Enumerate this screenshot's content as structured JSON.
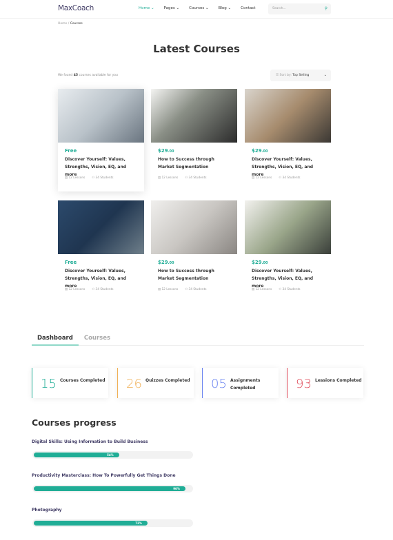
{
  "header": {
    "logo": "MaxCoach",
    "nav": [
      "Home",
      "Pages",
      "Courses",
      "Blog",
      "Contact"
    ],
    "search_placeholder": "Search..."
  },
  "breadcrumb": {
    "home": "Home",
    "sep": "/",
    "current": "Courses"
  },
  "page_title": "Latest Courses",
  "found": {
    "pre": "We found",
    "count": "45",
    "post": "courses available for you"
  },
  "sort": {
    "label": "Sort by:",
    "value": "Top Selling"
  },
  "courses": [
    {
      "price": "Free",
      "cents": "",
      "title": "Discover Yourself: Values, Strengths, Vision, EQ, and more",
      "lessons": "12 Lessons",
      "students": "34 Students"
    },
    {
      "price": "$29",
      "cents": ".00",
      "title": "How to Success through Market Segmentation",
      "lessons": "12 Lessons",
      "students": "34 Students"
    },
    {
      "price": "$29",
      "cents": ".00",
      "title": "Discover Yourself: Values, Strengths, Vision, EQ, and more",
      "lessons": "12 Lessons",
      "students": "34 Students"
    },
    {
      "price": "Free",
      "cents": "",
      "title": "Discover Yourself: Values, Strengths, Vision, EQ, and more",
      "lessons": "12 Lessons",
      "students": "34 Students"
    },
    {
      "price": "$29",
      "cents": ".00",
      "title": "How to Success through Market Segmentation",
      "lessons": "12 Lessons",
      "students": "34 Students"
    },
    {
      "price": "$29",
      "cents": ".00",
      "title": "Discover Yourself: Values, Strengths, Vision, EQ, and more",
      "lessons": "12 Lessons",
      "students": "34 Students"
    }
  ],
  "tabs": [
    "Dashboard",
    "Courses"
  ],
  "stats": [
    {
      "num": "15",
      "label": "Courses Completed",
      "color": "#20ad96"
    },
    {
      "num": "26",
      "label": "Quizzes Completed",
      "color": "#f0b056"
    },
    {
      "num": "05",
      "label": "Assignments Completed",
      "color": "#6a83f0"
    },
    {
      "num": "93",
      "label": "Lessions Completed",
      "color": "#e0505e"
    }
  ],
  "progress_title": "Courses progress",
  "progress": [
    {
      "name": "Digital Skills: Using Information to Build Business",
      "percent": 54,
      "label": "54%"
    },
    {
      "name": "Productivity Masterclass: How To Powerfully Get Things Done",
      "percent": 96,
      "label": "96%"
    },
    {
      "name": "Photography",
      "percent": 72,
      "label": "72%"
    }
  ]
}
